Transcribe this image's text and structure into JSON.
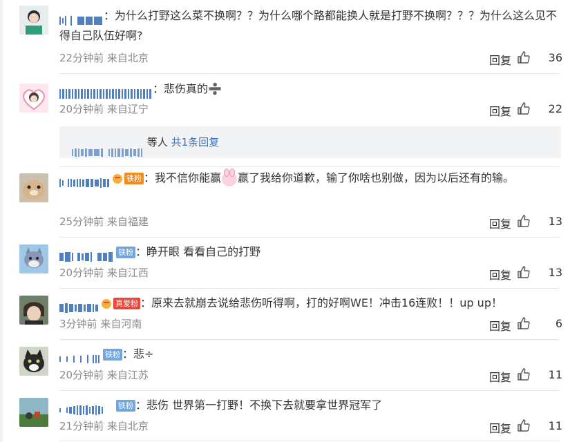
{
  "comments": [
    {
      "text": "：为什么打野这么菜不换啊？？为什么哪个路都能换人就是打野不换啊？？？为什么这么见不得自己队伍好啊?",
      "time": "22分钟前",
      "location": "来自北京",
      "reply_label": "回复",
      "likes": "36",
      "avatar": "person-avatar"
    },
    {
      "text": "：悲伤真的➗",
      "time": "20分钟前",
      "location": "来自辽宁",
      "reply_label": "回复",
      "likes": "22",
      "avatar": "heart-girl-avatar",
      "sub_reply": {
        "suffix": "等人",
        "link": "共1条回复"
      }
    },
    {
      "badge": "铁粉",
      "text_a": "：我不信你能赢",
      "text_b": "赢了我给你道歉，输了你啥也别做，因为以后还有的输。",
      "time": "25分钟前",
      "location": "来自福建",
      "reply_label": "回复",
      "likes": "13",
      "avatar": "hamster-avatar"
    },
    {
      "badge": "铁粉",
      "text": "：睁开眼 看看自己的打野",
      "time": "20分钟前",
      "location": "来自江西",
      "reply_label": "回复",
      "likes": "13",
      "avatar": "cartoon-cat-avatar"
    },
    {
      "badge": "真爱粉",
      "text": "：原来去就崩去说给悲伤听得啊，打的好啊WE！冲击16连败！！up up！",
      "time": "3分钟前",
      "location": "来自河南",
      "reply_label": "回复",
      "likes": "6",
      "avatar": "anime-avatar"
    },
    {
      "badge": "铁粉",
      "text": "：悲÷",
      "time": "20分钟前",
      "location": "来自江苏",
      "reply_label": "回复",
      "likes": "11",
      "avatar": "cat-avatar"
    },
    {
      "badge": "铁粉",
      "text": "：悲伤 世界第一打野！不换下去就要拿世界冠军了",
      "time": "21分钟前",
      "location": "来自北京",
      "reply_label": "回复",
      "likes": "11",
      "avatar": "landscape-avatar"
    }
  ],
  "colors": {
    "link": "#3f73b6",
    "badge_iron": "#6fa6e0",
    "badge_real": "#e8483c",
    "meta": "#8a8a8a"
  }
}
